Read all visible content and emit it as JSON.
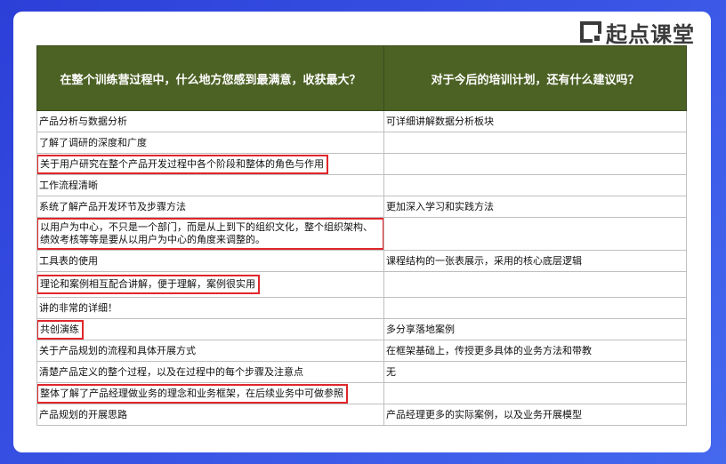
{
  "brand": {
    "name": "起点课堂",
    "accent": "#e0262a",
    "header_color": "#4c6124"
  },
  "table": {
    "headers": [
      "在整个训练营过程中，什么地方您感到最满意，收获最大？",
      "对于今后的培训计划，还有什么建议吗？"
    ],
    "rows": [
      {
        "a": "产品分析与数据分析",
        "b": "可详细讲解数据分析板块"
      },
      {
        "a": "了解了调研的深度和广度",
        "b": ""
      },
      {
        "a": "关于用户研究在整个产品开发过程中各个阶段和整体的角色与作用",
        "b": ""
      },
      {
        "a": "工作流程清晰",
        "b": ""
      },
      {
        "a": "系统了解产品开发环节及步骤方法",
        "b": "更加深入学习和实践方法"
      },
      {
        "a": "以用户为中心，不只是一个部门，而是从上到下的组织文化，整个组织架构、绩效考核等等是要从以用户为中心的角度来调整的。",
        "b": ""
      },
      {
        "a": "工具表的使用",
        "b": "课程结构的一张表展示，采用的核心底层逻辑"
      },
      {
        "a": "理论和案例相互配合讲解，便于理解，案例很实用",
        "b": ""
      },
      {
        "a": "讲的非常的详细！",
        "b": ""
      },
      {
        "a": "共创演练",
        "b": "多分享落地案例"
      },
      {
        "a": "关于产品规划的流程和具体开展方式",
        "b": "在框架基础上，传授更多具体的业务方法和带教"
      },
      {
        "a": "清楚产品定义的整个过程，以及在过程中的每个步骤及注意点",
        "b": "无"
      },
      {
        "a": "整体了解了产品经理做业务的理念和业务框架，在后续业务中可做参照",
        "b": ""
      },
      {
        "a": "产品规划的开展思路",
        "b": "产品经理更多的实际案例，以及业务开展模型"
      }
    ]
  }
}
